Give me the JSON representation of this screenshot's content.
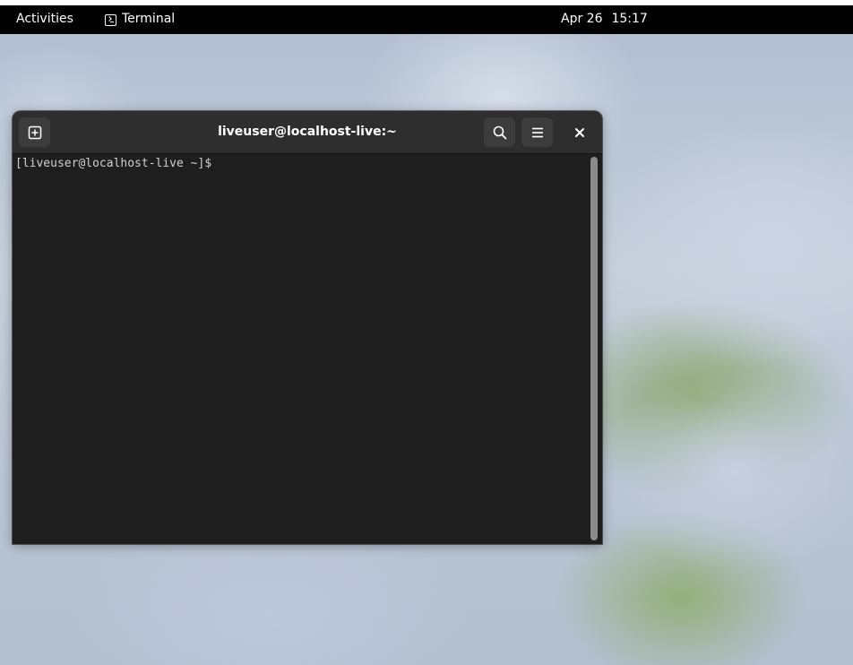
{
  "topbar": {
    "activities_label": "Activities",
    "app_name": "Terminal",
    "app_icon": "terminal-icon",
    "clock": {
      "date": "Apr 26",
      "time": "15:17"
    }
  },
  "window": {
    "title": "liveuser@localhost-live:~",
    "buttons": {
      "new_tab_icon": "new-tab-icon",
      "search_icon": "search-icon",
      "menu_icon": "hamburger-menu-icon",
      "close_icon": "close-icon"
    },
    "terminal": {
      "lines": [
        "[liveuser@localhost-live ~]$ "
      ]
    }
  },
  "colors": {
    "topbar_bg": "#000000",
    "headerbar_bg": "#2e2e2e",
    "terminal_bg": "#1e1e1e",
    "terminal_fg": "#d0d0d0"
  }
}
